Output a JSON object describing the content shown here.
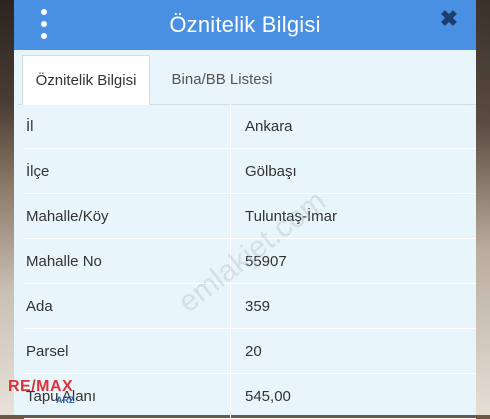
{
  "dialog": {
    "title": "Öznitelik Bilgisi",
    "menu_icon": "vertical-dots-icon",
    "close_icon": "close-icon"
  },
  "tabs": [
    {
      "label": "Öznitelik Bilgisi",
      "active": true
    },
    {
      "label": "Bina/BB Listesi",
      "active": false
    }
  ],
  "rows": [
    {
      "label": "İl",
      "value": "Ankara"
    },
    {
      "label": "İlçe",
      "value": "Gölbaşı"
    },
    {
      "label": "Mahalle/Köy",
      "value": "Tuluntaş-İmar"
    },
    {
      "label": "Mahalle No",
      "value": "55907"
    },
    {
      "label": "Ada",
      "value": "359"
    },
    {
      "label": "Parsel",
      "value": "20"
    },
    {
      "label": "Tapu Alanı",
      "value": "545,00"
    }
  ],
  "watermark": "emlakjet.com",
  "logo": {
    "text": "RE/MAX",
    "sub": "ARZ"
  },
  "colors": {
    "accent": "#4a90e2",
    "panel": "#e8f5fa",
    "logo": "#d9343a"
  }
}
